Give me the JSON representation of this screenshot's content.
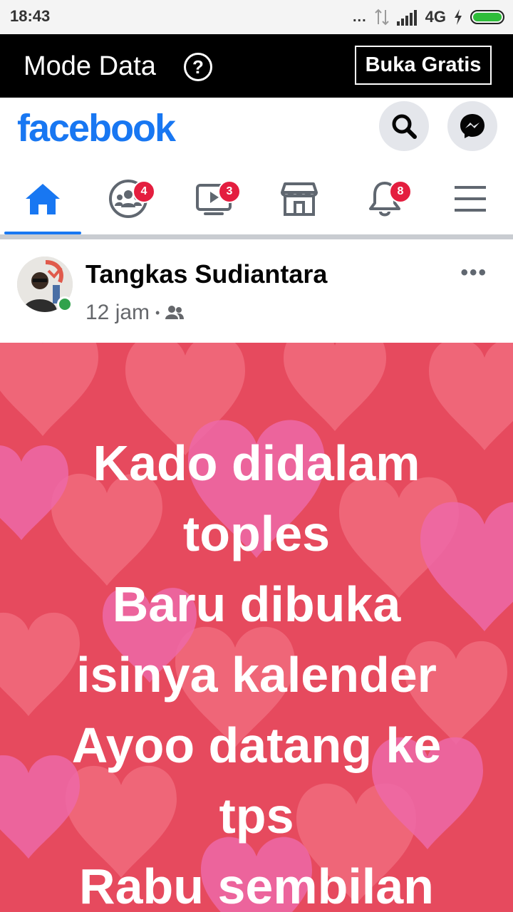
{
  "status_bar": {
    "time": "18:43",
    "dots": "...",
    "network": "4G",
    "battery_level": 1.0
  },
  "data_mode": {
    "title": "Mode Data",
    "help_symbol": "?",
    "button_label": "Buka Gratis"
  },
  "header": {
    "logo": "facebook",
    "icons": [
      "search-icon",
      "messenger-icon"
    ]
  },
  "nav": {
    "tabs": [
      {
        "name": "home",
        "icon": "home-icon",
        "badge": ""
      },
      {
        "name": "groups",
        "icon": "groups-icon",
        "badge": "4"
      },
      {
        "name": "watch",
        "icon": "video-icon",
        "badge": "3"
      },
      {
        "name": "marketplace",
        "icon": "shop-icon",
        "badge": ""
      },
      {
        "name": "notifications",
        "icon": "bell-icon",
        "badge": "8"
      },
      {
        "name": "menu",
        "icon": "hamburger-icon",
        "badge": ""
      }
    ],
    "active_tab": "home"
  },
  "post": {
    "author": "Tangkas Sudiantara",
    "time": "12 jam",
    "separator": "•",
    "audience_icon": "friends-icon",
    "more": "•••",
    "text_lines": [
      "Kado didalam",
      "toples",
      "Baru dibuka",
      "isinya kalender",
      "Ayoo datang ke",
      "tps",
      "Rabu sembilan"
    ]
  },
  "colors": {
    "brand": "#1877f2",
    "badge": "#e41e3f",
    "online": "#31a24c",
    "post_background": "#e64a5e",
    "heart_pink": "#ee6aa8",
    "heart_red": "#f1707e"
  }
}
